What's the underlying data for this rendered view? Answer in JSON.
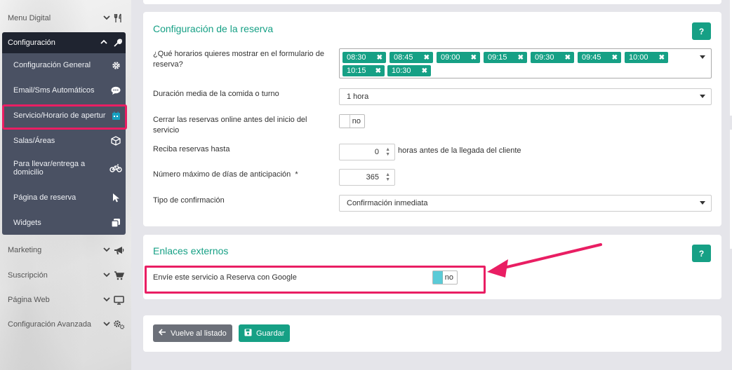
{
  "sidebar": {
    "menu_digital": "Menu Digital",
    "configuracion": "Configuración",
    "sub_items": [
      {
        "label": "Configuración General",
        "icon": "gear-icon"
      },
      {
        "label": "Email/Sms Automáticos",
        "icon": "chat-bubble-icon"
      },
      {
        "label": "Servicio/Horario de apertura",
        "icon": "calendar-icon"
      },
      {
        "label": "Salas/Áreas",
        "icon": "cube-icon"
      },
      {
        "label": "Para llevar/entrega a domicilio",
        "icon": "bicycle-icon"
      },
      {
        "label": "Página de reserva",
        "icon": "cursor-icon"
      },
      {
        "label": "Widgets",
        "icon": "copy-icon"
      }
    ],
    "bottom_items": [
      {
        "label": "Marketing",
        "icon": "megaphone-icon"
      },
      {
        "label": "Suscripción",
        "icon": "cart-icon"
      },
      {
        "label": "Página Web",
        "icon": "monitor-icon"
      },
      {
        "label": "Configuración Avanzada",
        "icon": "gears-icon"
      }
    ]
  },
  "reserva": {
    "title": "Configuración de la reserva",
    "help": "?",
    "horarios_label": "¿Qué horarios quieres mostrar en el formulario de reserva?",
    "horarios": [
      "08:30",
      "08:45",
      "09:00",
      "09:15",
      "09:30",
      "09:45",
      "10:00",
      "10:15",
      "10:30"
    ],
    "duracion_label": "Duración media de la comida o turno",
    "duracion_value": "1 hora",
    "cerrar_label": "Cerrar las reservas online antes del inicio del servicio",
    "cerrar_toggle": "no",
    "recibir_label": "Reciba reservas hasta",
    "recibir_value": "0",
    "recibir_suffix": "horas antes de la llegada del cliente",
    "max_dias_label": "Número máximo de días de anticipación",
    "max_dias_required": "*",
    "max_dias_value": "365",
    "tipo_label": "Tipo de confirmación",
    "tipo_value": "Confirmación inmediata"
  },
  "enlaces": {
    "title": "Enlaces externos",
    "help": "?",
    "google_label": "Envíe este servicio a Reserva con Google",
    "google_toggle": "no"
  },
  "actions": {
    "back": "Vuelve al listado",
    "save": "Guardar"
  },
  "colors": {
    "accent": "#16a085",
    "highlight": "#e91e63",
    "sidebar_dark": "#1f2430",
    "submenu": "#4a5163"
  }
}
